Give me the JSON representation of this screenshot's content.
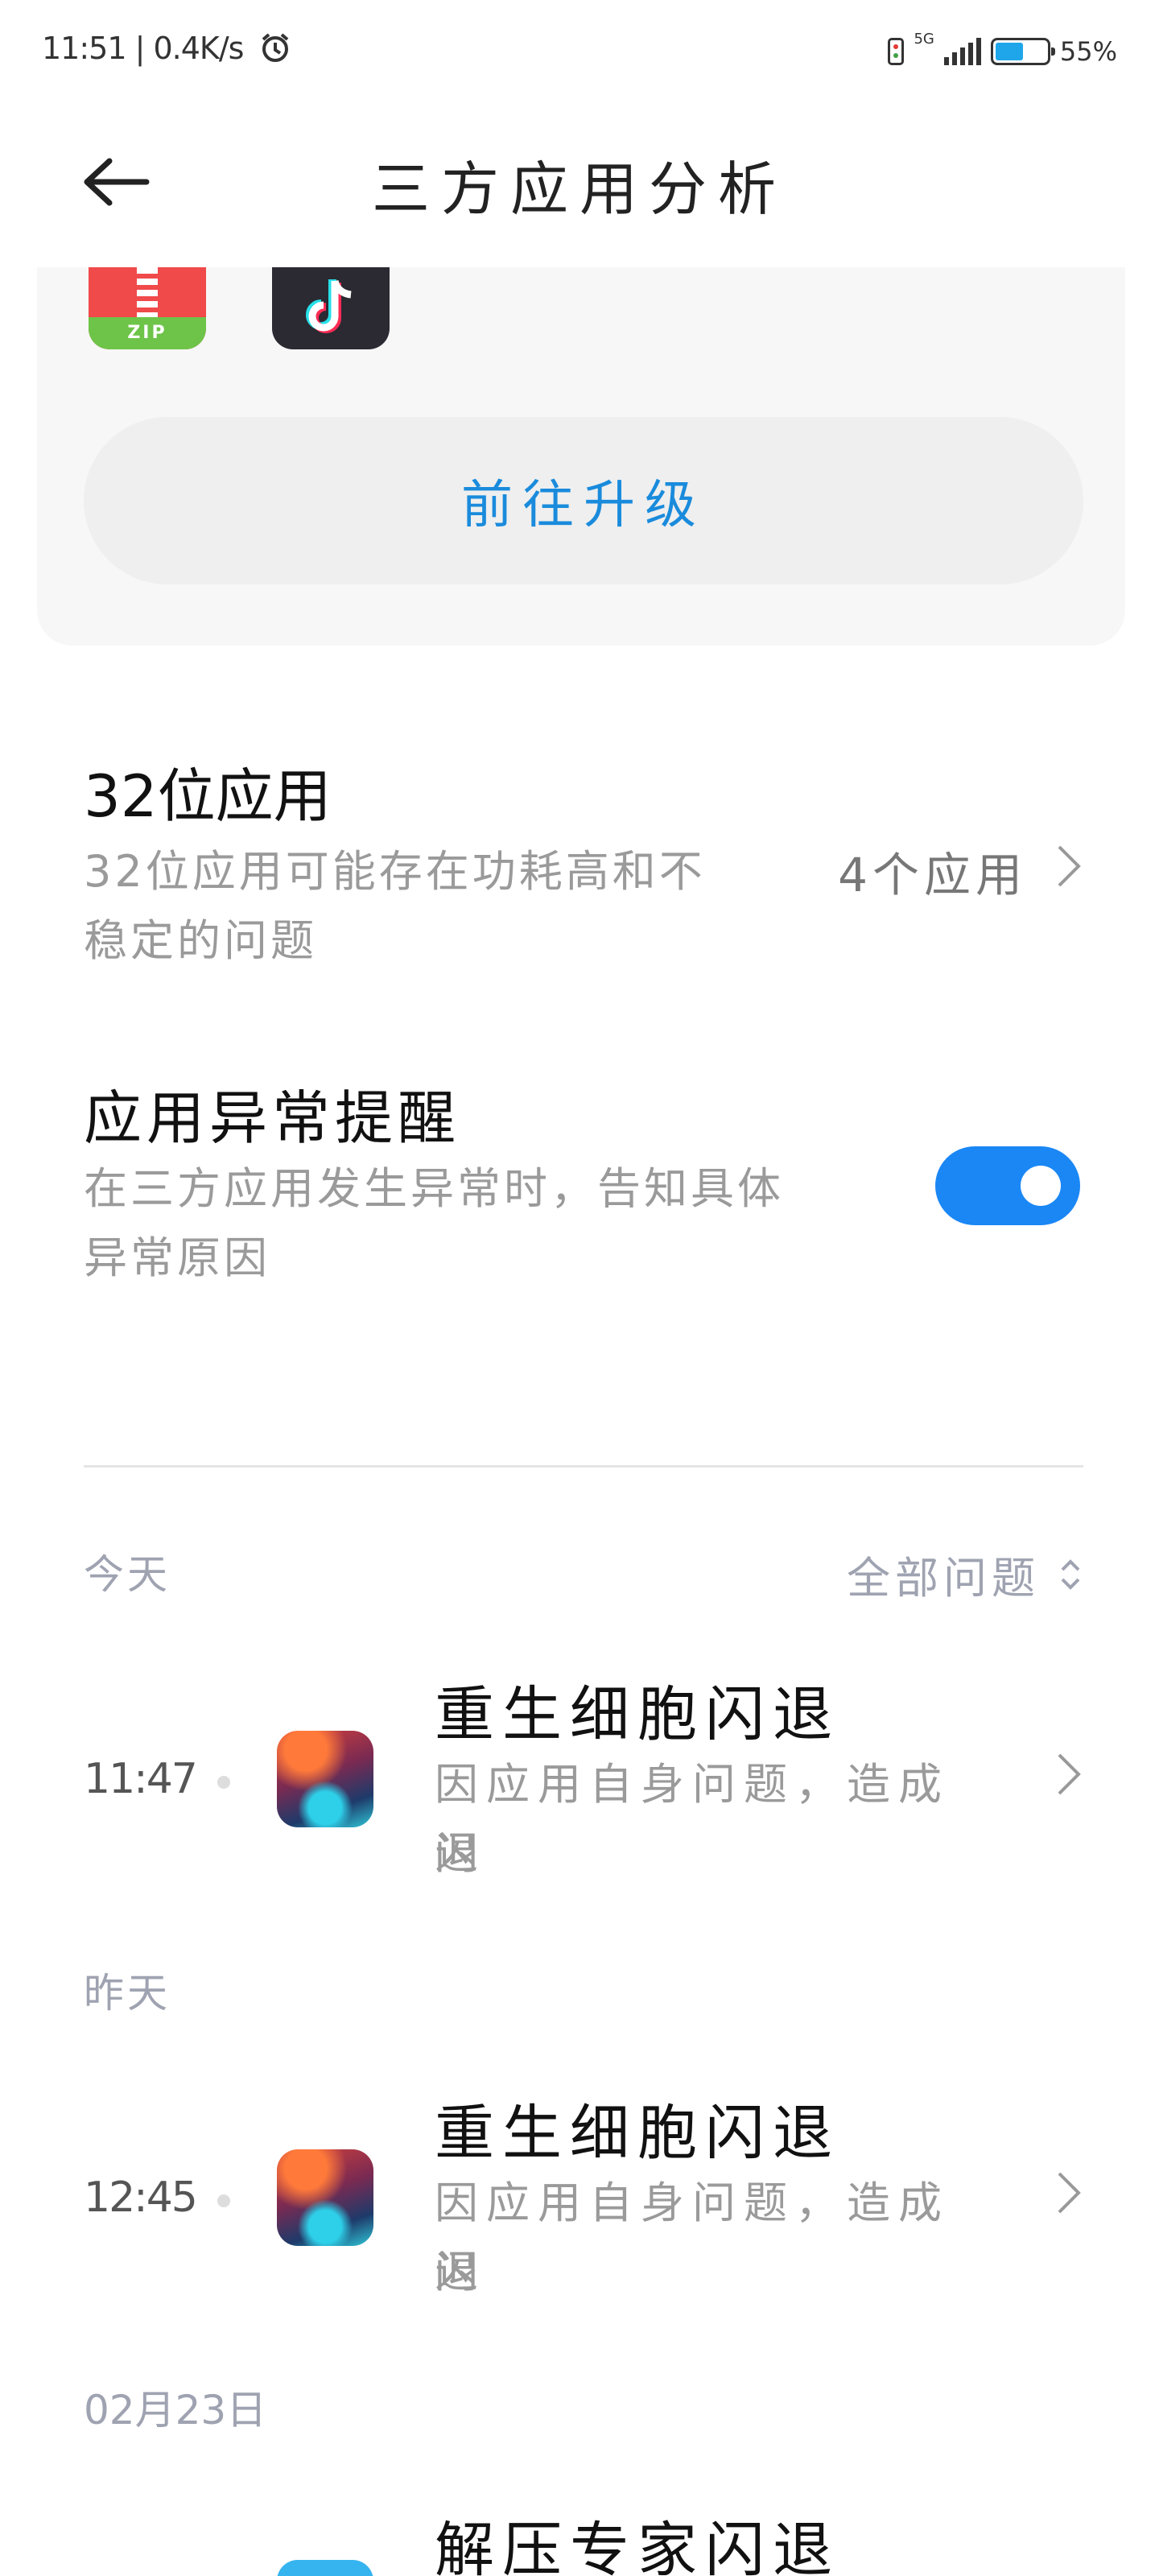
{
  "status_bar": {
    "left_text": "11:51 | 0.4K/s",
    "network_label": "5G",
    "battery": "55%",
    "battery_level": 0.55
  },
  "header": {
    "title": "三方应用分析"
  },
  "upgrade_card": {
    "app_icons": [
      "zip-app-icon",
      "tiktok-icon"
    ],
    "zip_text": "ZIP",
    "button_label": "前往升级"
  },
  "settings": {
    "apps32": {
      "title": "32位应用",
      "desc_line1": "32位应用可能存在功耗高和不",
      "desc_line2": "稳定的问题",
      "value": "4个应用"
    },
    "anomaly": {
      "title": "应用异常提醒",
      "desc_line1": "在三方应用发生异常时，告知具体",
      "desc_line2": "异常原因",
      "enabled": true
    }
  },
  "crash_list": {
    "filter_label": "全部问题",
    "groups": [
      {
        "date": "今天",
        "items": [
          {
            "time": "11:47",
            "title": "重生细胞闪退",
            "desc_line1": "因应用自身问题，造成闪",
            "desc_line2": "退"
          }
        ]
      },
      {
        "date": "昨天",
        "items": [
          {
            "time": "12:45",
            "title": "重生细胞闪退",
            "desc_line1": "因应用自身问题，造成闪",
            "desc_line2": "退"
          }
        ]
      },
      {
        "date": "02月23日",
        "items": [
          {
            "title": "解压专家闪退"
          }
        ]
      }
    ]
  },
  "colors": {
    "accent": "#1a87f5",
    "link": "#1a8bdc",
    "muted": "#9a9a9a"
  }
}
